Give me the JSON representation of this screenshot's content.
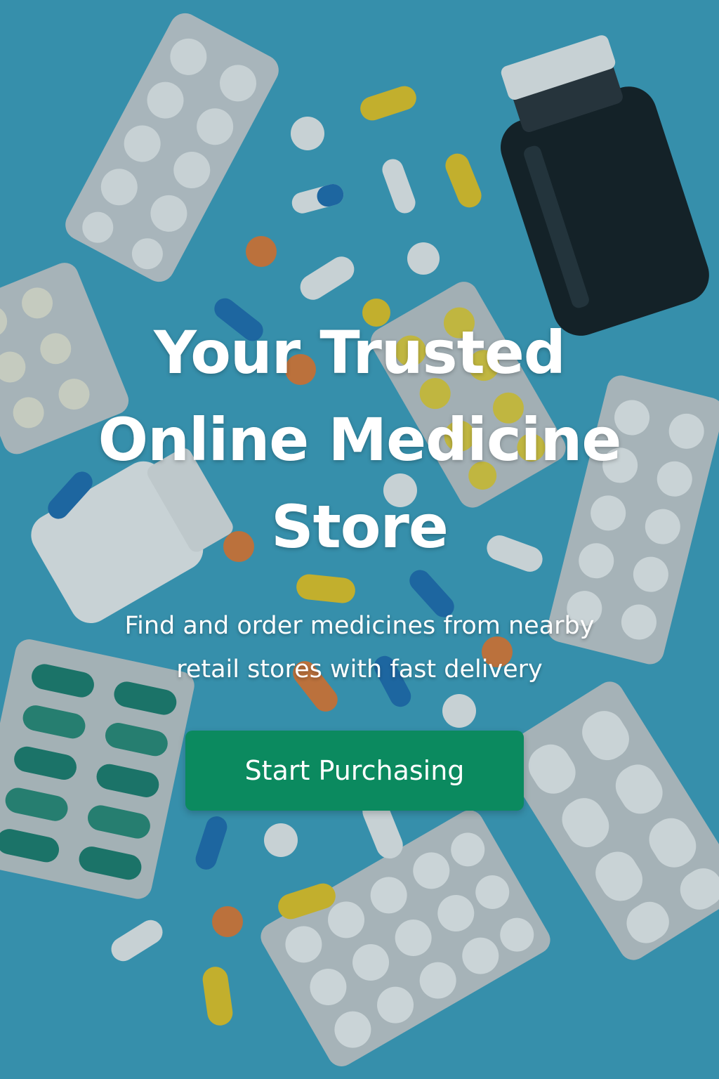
{
  "hero": {
    "title_lines": [
      "Your Trusted",
      "Online Medicine",
      "Store"
    ],
    "subtitle_lines": [
      "Find and order medicines from nearby",
      "retail stores with fast delivery"
    ]
  },
  "cta": {
    "label": "Start Purchasing"
  },
  "colors": {
    "background": "#3e9fbd",
    "button": "#0b8a5f",
    "text": "#ffffff"
  },
  "background_image": {
    "subject": "pills-blister-packs-and-bottles"
  }
}
